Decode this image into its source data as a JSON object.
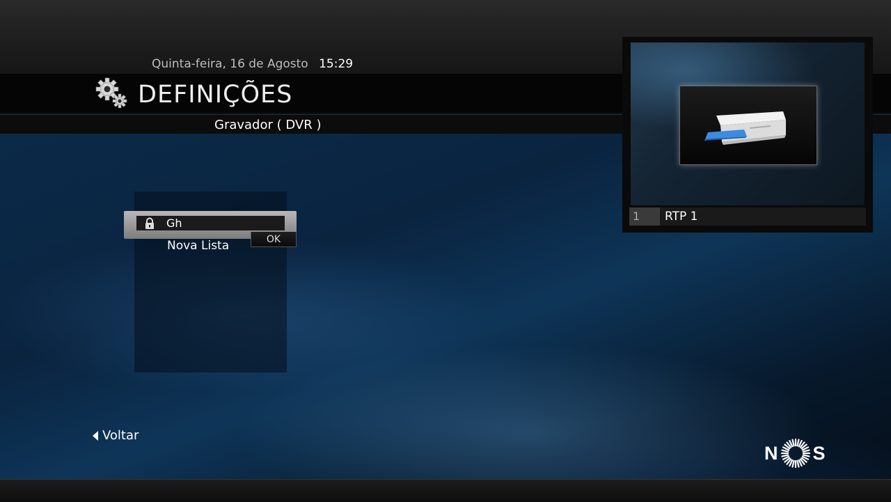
{
  "header": {
    "date": "Quinta-feira, 16 de Agosto",
    "time": "15:29",
    "title": "DEFINIÇÕES",
    "subtitle": "Gravador ( DVR )"
  },
  "dialog": {
    "input_value": "Gh",
    "ok_label": "OK"
  },
  "list": {
    "items": [
      "Nova Lista"
    ]
  },
  "preview": {
    "channel_number": "1",
    "channel_name": "RTP 1"
  },
  "footer": {
    "back_label": "Voltar",
    "logo": {
      "left": "N",
      "right": "S"
    }
  },
  "icons": [
    "gear-icon",
    "lock-icon",
    "back-arrow-icon",
    "nos-sun-icon",
    "printer-icon"
  ]
}
